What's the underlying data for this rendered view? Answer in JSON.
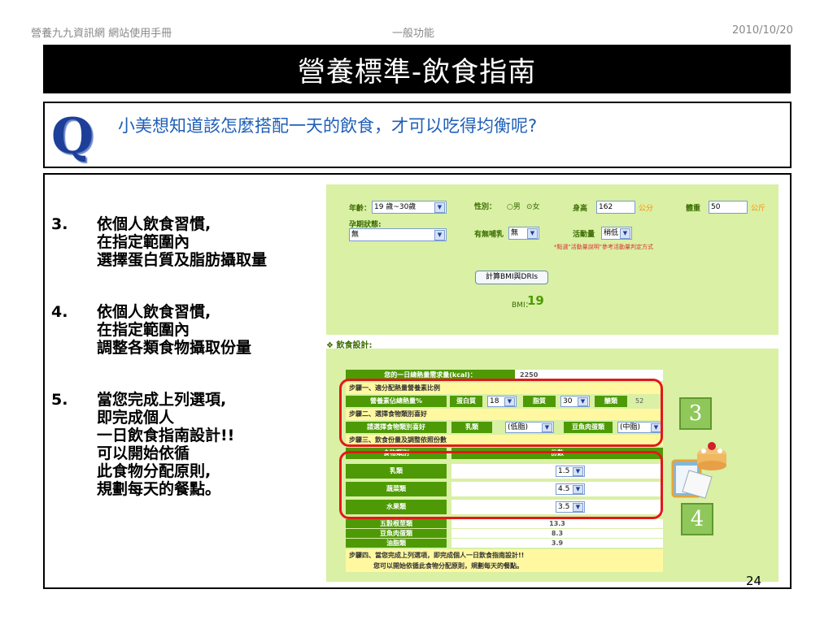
{
  "header": {
    "left": "營養九九資訊網 網站使用手冊",
    "center": "一般功能",
    "right": "2010/10/20"
  },
  "title": "營養標準-飲食指南",
  "question": {
    "icon": "Q",
    "text": "小美想知道該怎麼搭配一天的飲食，才可以吃得均衡呢?"
  },
  "steps": [
    {
      "num": "3.",
      "lines": [
        "依個人飲食習慣,",
        "在指定範圍內",
        "選擇蛋白質及脂肪攝取量"
      ]
    },
    {
      "num": "4.",
      "lines": [
        "依個人飲食習慣,",
        "在指定範圍內",
        "調整各類食物攝取份量"
      ]
    },
    {
      "num": "5.",
      "lines": [
        "當您完成上列選項,",
        "即完成個人",
        "一日飲食指南設計!!",
        "可以開始依循",
        "此食物分配原則,",
        "規劃每天的餐點。"
      ]
    }
  ],
  "form": {
    "age_label": "年齡：",
    "age_value": "19 歲~30歲",
    "gender_label": "性別：",
    "gender_male": "男",
    "gender_female": "女",
    "height_label": "身高",
    "height_value": "162",
    "height_unit": "公分",
    "weight_label": "體重",
    "weight_value": "50",
    "weight_unit": "公斤",
    "pregnancy_label": "孕期狀態:",
    "pregnancy_value": "無",
    "breastfeeding_label": "有無哺乳",
    "breastfeeding_value": "無",
    "activity_label": "活動量",
    "activity_value": "稍低",
    "note": "*點選\"活動量說明\"參考活動量判定方式",
    "bmi_button": "計算BMI與DRIs",
    "bmi_label": "BMI：",
    "bmi_value": "19"
  },
  "diet": {
    "heading": "飲食設計:",
    "energy_row": {
      "label": "您的一日總熱量需求量(kcal)：",
      "value": "2250"
    },
    "step1": "步驟一、適分配熱量營養素比例",
    "ratio_row": {
      "label": "營養素佔總熱量%",
      "protein_label": "蛋白質",
      "protein_value": "18",
      "fat_label": "脂質",
      "fat_value": "30",
      "carb_label": "醣類",
      "carb_value": "52"
    },
    "step2": "步驟二、選擇食物類別喜好",
    "pref_row": {
      "label": "請選擇食物類別喜好",
      "milk_label": "乳類",
      "milk_value": "(低脂)",
      "meat_label": "豆魚肉蛋類",
      "meat_value": "(中脂)"
    },
    "step3": "步驟三、飲食份量及調整依照份數",
    "table_header": {
      "col1": "食物類別",
      "col2": "份數"
    },
    "adjustable": [
      {
        "name": "乳類",
        "value": "1.5"
      },
      {
        "name": "蔬菜類",
        "value": "4.5"
      },
      {
        "name": "水果類",
        "value": "3.5"
      }
    ],
    "fixed": [
      {
        "name": "五穀根莖類",
        "value": "13.3"
      },
      {
        "name": "豆魚肉蛋類",
        "value": "8.3"
      },
      {
        "name": "油脂類",
        "value": "3.9"
      }
    ],
    "step4_line1": "步驟四、當您完成上列選項，即完成個人一日飲食指南設計!!",
    "step4_line2": "您可以開始依循此食物分配原則，規劃每天的餐點。"
  },
  "badges": {
    "b3": "3",
    "b4": "4"
  },
  "page_number": "24"
}
